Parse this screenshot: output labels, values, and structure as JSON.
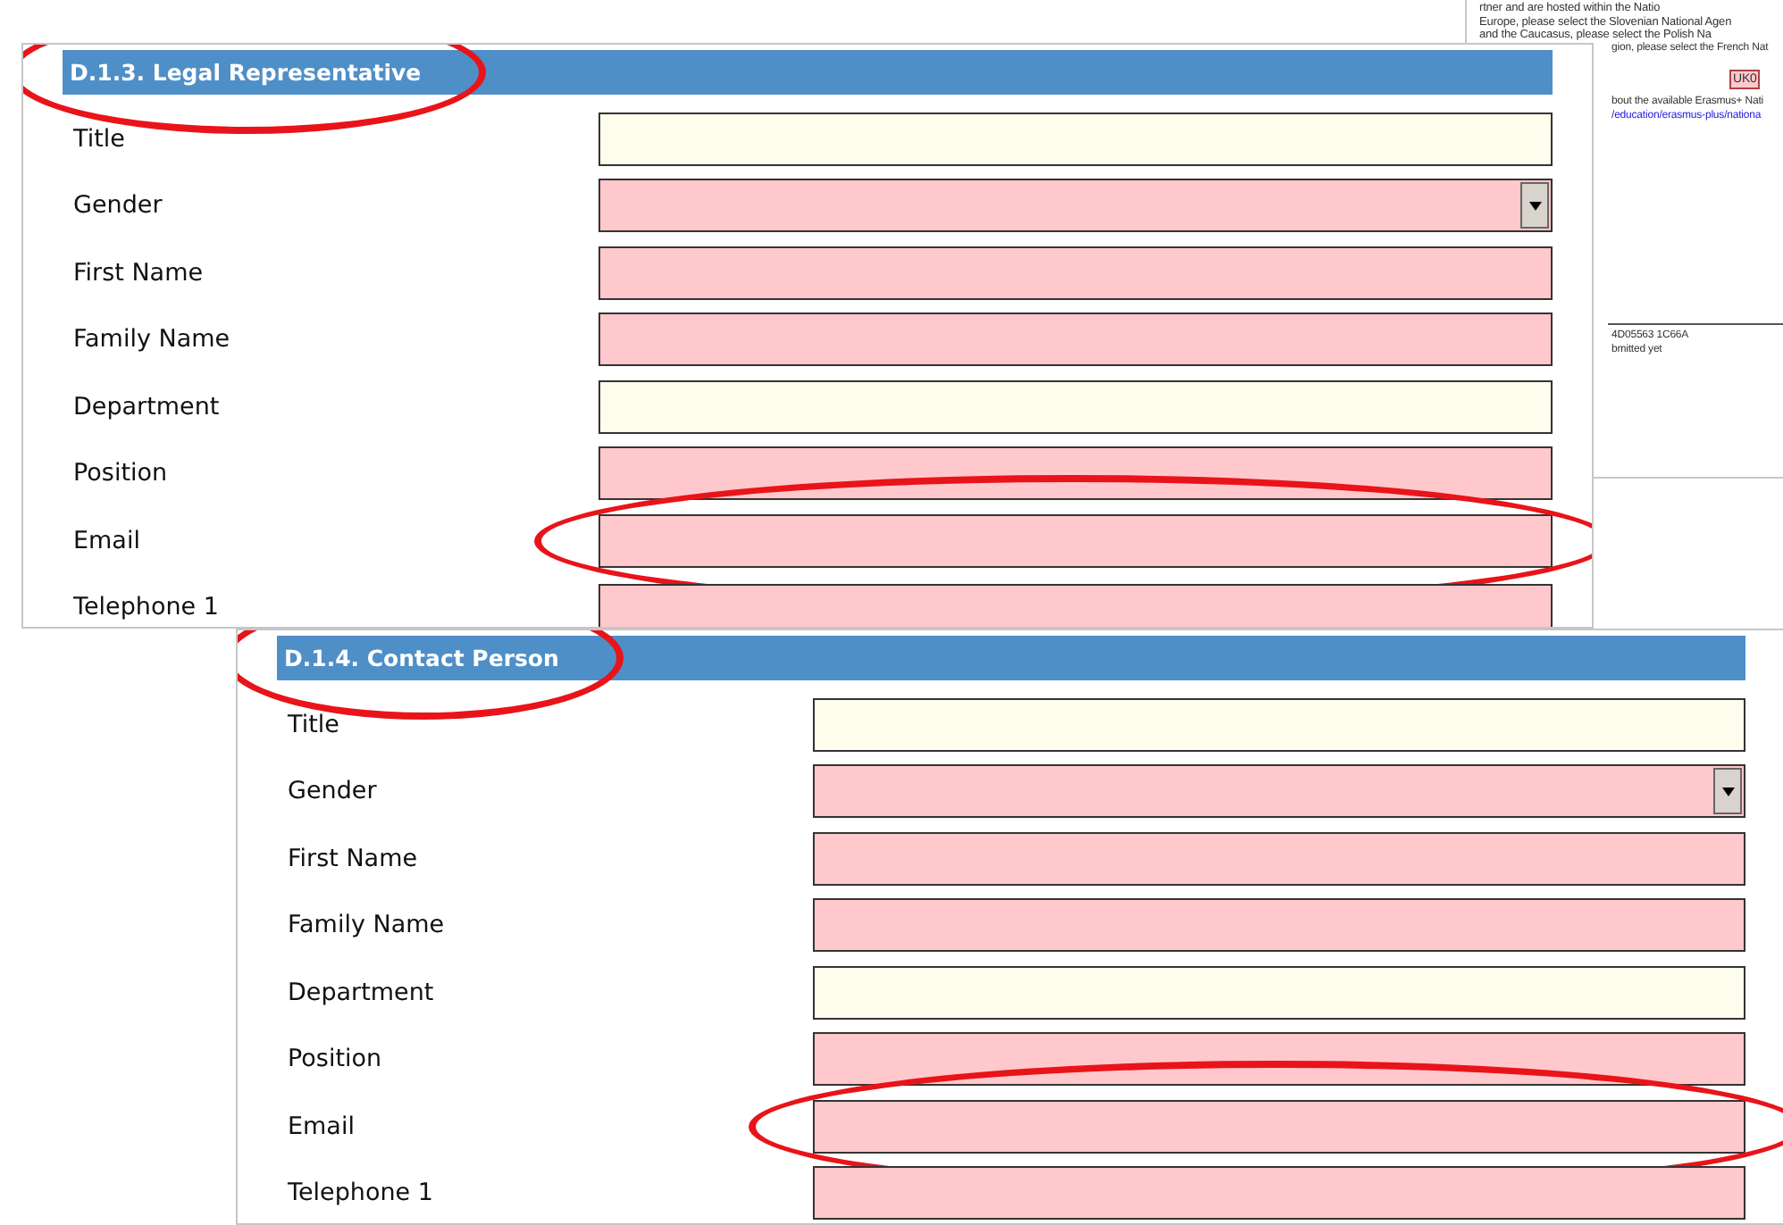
{
  "background_document": {
    "lines": [
      "rtner and are hosted within the Natio",
      "Europe, please select the Slovenian National Agen",
      "and the Caucasus, please select the Polish Na",
      "gion, please select the French Nat"
    ],
    "badge": "UK0",
    "note": "bout the available Erasmus+ Nati",
    "link": "/education/erasmus-plus/nationa",
    "footer_lines": [
      "4D05563 1C66A",
      "bmitted yet"
    ]
  },
  "sections": [
    {
      "title": "D.1.3. Legal Representative",
      "circled": true,
      "fields": [
        {
          "label": "Title",
          "kind": "text",
          "required": false,
          "circled": false
        },
        {
          "label": "Gender",
          "kind": "select",
          "required": true,
          "circled": false
        },
        {
          "label": "First Name",
          "kind": "text",
          "required": true,
          "circled": false
        },
        {
          "label": "Family Name",
          "kind": "text",
          "required": true,
          "circled": false
        },
        {
          "label": "Department",
          "kind": "text",
          "required": false,
          "circled": false
        },
        {
          "label": "Position",
          "kind": "text",
          "required": true,
          "circled": false
        },
        {
          "label": "Email",
          "kind": "text",
          "required": true,
          "circled": true
        },
        {
          "label": "Telephone 1",
          "kind": "text",
          "required": true,
          "circled": false
        }
      ]
    },
    {
      "title": "D.1.4. Contact Person",
      "circled": true,
      "fields": [
        {
          "label": "Title",
          "kind": "text",
          "required": false,
          "circled": false
        },
        {
          "label": "Gender",
          "kind": "select",
          "required": true,
          "circled": false
        },
        {
          "label": "First Name",
          "kind": "text",
          "required": true,
          "circled": false
        },
        {
          "label": "Family Name",
          "kind": "text",
          "required": true,
          "circled": false
        },
        {
          "label": "Department",
          "kind": "text",
          "required": false,
          "circled": false
        },
        {
          "label": "Position",
          "kind": "text",
          "required": true,
          "circled": false
        },
        {
          "label": "Email",
          "kind": "text",
          "required": true,
          "circled": true
        },
        {
          "label": "Telephone 1",
          "kind": "text",
          "required": true,
          "circled": false
        }
      ]
    }
  ]
}
